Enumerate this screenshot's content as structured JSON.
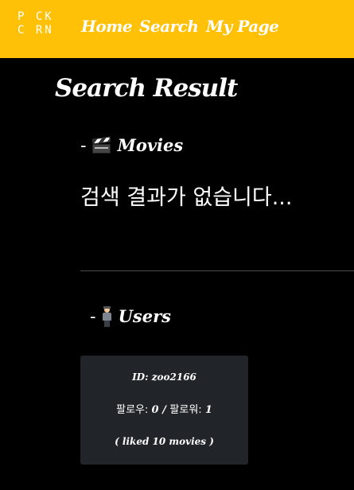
{
  "brand": {
    "logo_text_top": "P CK",
    "logo_text_bottom": "C RN"
  },
  "nav": {
    "home": "Home",
    "search": "Search",
    "my_page": "My Page"
  },
  "page": {
    "title": "Search Result"
  },
  "movies_section": {
    "dash": "-",
    "icon": "clapper-board-icon",
    "heading": "Movies",
    "empty_message": "검색 결과가 없습니다..."
  },
  "users_section": {
    "dash": "-",
    "icon": "person-icon",
    "heading": "Users",
    "users": [
      {
        "id_line": "ID: zoo2166",
        "following_label": "팔로우: ",
        "following_count": "0",
        "separator": " / ",
        "followers_label": "팔로워: ",
        "followers_count": "1",
        "liked_line": "( liked 10 movies )"
      }
    ]
  },
  "colors": {
    "navbar": "#ffc107",
    "background": "#000000",
    "card": "#212529",
    "text": "#ffffff"
  }
}
